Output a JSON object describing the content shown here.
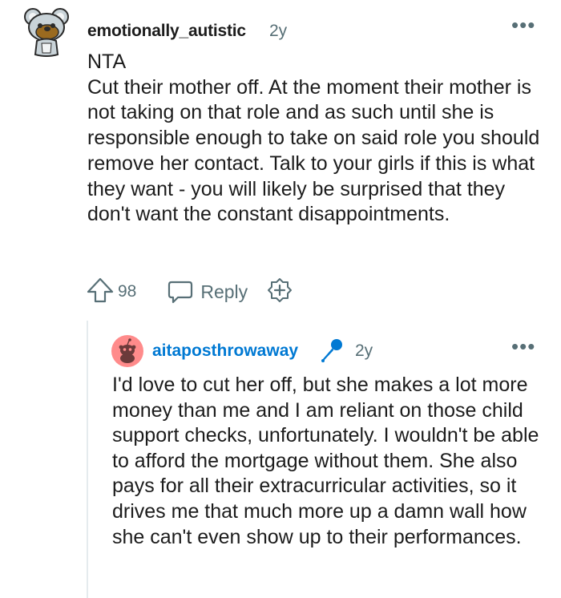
{
  "comment": {
    "author": "emotionally_autistic",
    "age": "2y",
    "more_label": "•••",
    "avatar_icon": "snoo-koala-avatar-icon",
    "body_lines": [
      "NTA",
      "Cut their mother off. At the moment their mother is not taking on that role and as such until she is responsible enough to take on said role you should remove her contact. Talk to your girls if this is what they want - you will likely be surprised that they don't want the constant disappointments."
    ],
    "score": "98",
    "reply_label": "Reply"
  },
  "reply": {
    "author": "aitaposthrowaway",
    "age": "2y",
    "more_label": "•••",
    "avatar_icon": "default-snoo-avatar-icon",
    "badge_icon": "microphone-icon",
    "body": "I'd love to cut her off, but she makes a lot more money than me and I am reliant on those child support checks, unfortunately. I wouldn't be able to afford the mortgage without them. She also pays for all their extracurricular activities, so it drives me that much more up a damn wall how she can't even show up to their performances."
  },
  "colors": {
    "text": "#1c1c1c",
    "meta": "#576f76",
    "op_username": "#0079d3",
    "mic": "#0079d3",
    "avatar2_bg": "#ff8b8b",
    "thread_line": "#e5ebee"
  }
}
